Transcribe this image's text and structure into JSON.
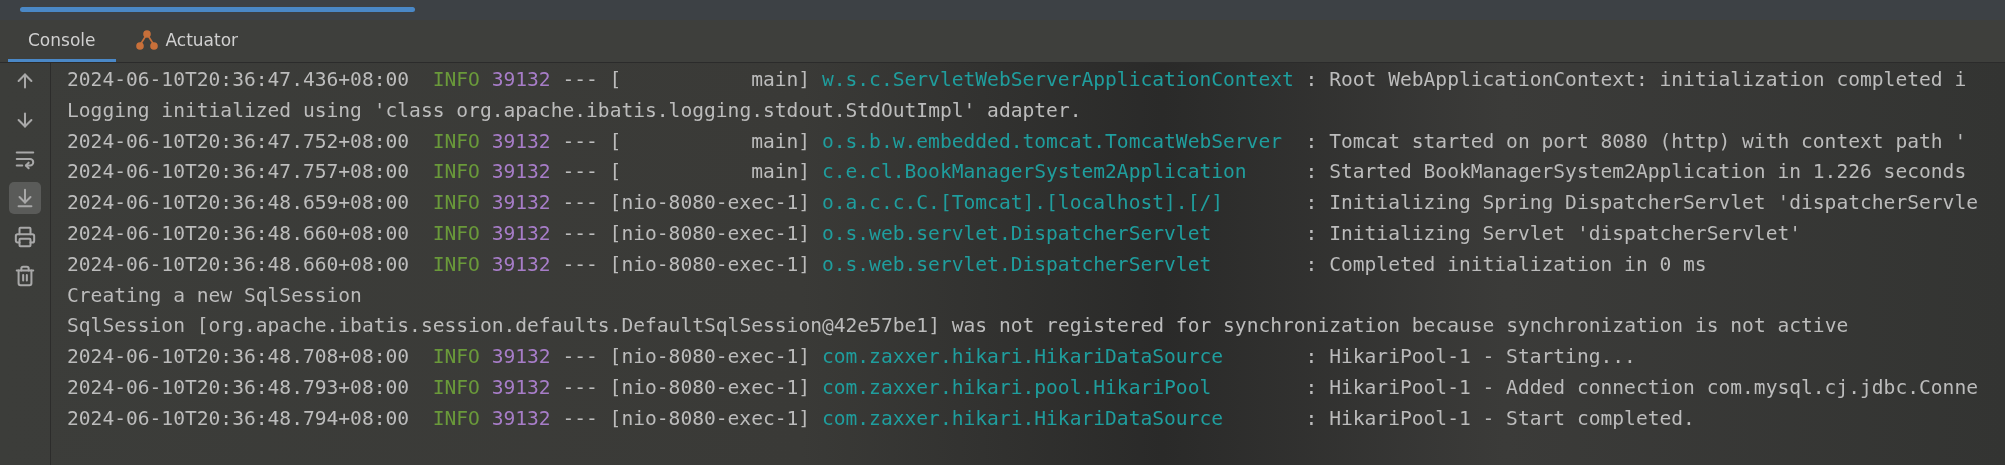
{
  "run_tab": {
    "selected": true
  },
  "tabs": [
    {
      "label": "Console",
      "kind": "plain",
      "selected": true
    },
    {
      "label": "Actuator",
      "kind": "actuator",
      "selected": false
    }
  ],
  "toolbar": [
    {
      "kind": "up",
      "on": false
    },
    {
      "kind": "down",
      "on": false
    },
    {
      "kind": "wrap",
      "on": false
    },
    {
      "kind": "scroll-end",
      "on": true
    },
    {
      "kind": "print",
      "on": false
    },
    {
      "kind": "trash",
      "on": false
    }
  ],
  "lines": [
    {
      "kind": "log",
      "timestamp": "2024-06-10T20:36:47.436+08:00",
      "level": "INFO",
      "pid": "39132",
      "thread": "--- [           main]",
      "logger": "w.s.c.ServletWebServerApplicationContext",
      "message": ": Root WebApplicationContext: initialization completed i"
    },
    {
      "kind": "plain",
      "text": "Logging initialized using 'class org.apache.ibatis.logging.stdout.StdOutImpl' adapter."
    },
    {
      "kind": "log",
      "timestamp": "2024-06-10T20:36:47.752+08:00",
      "level": "INFO",
      "pid": "39132",
      "thread": "--- [           main]",
      "logger": "o.s.b.w.embedded.tomcat.TomcatWebServer",
      "message": ": Tomcat started on port 8080 (http) with context path '"
    },
    {
      "kind": "log",
      "timestamp": "2024-06-10T20:36:47.757+08:00",
      "level": "INFO",
      "pid": "39132",
      "thread": "--- [           main]",
      "logger": "c.e.cl.BookManagerSystem2Application",
      "message": ": Started BookManagerSystem2Application in 1.226 seconds"
    },
    {
      "kind": "log",
      "timestamp": "2024-06-10T20:36:48.659+08:00",
      "level": "INFO",
      "pid": "39132",
      "thread": "--- [nio-8080-exec-1]",
      "logger": "o.a.c.c.C.[Tomcat].[localhost].[/]",
      "message": ": Initializing Spring DispatcherServlet 'dispatcherServle"
    },
    {
      "kind": "log",
      "timestamp": "2024-06-10T20:36:48.660+08:00",
      "level": "INFO",
      "pid": "39132",
      "thread": "--- [nio-8080-exec-1]",
      "logger": "o.s.web.servlet.DispatcherServlet",
      "message": ": Initializing Servlet 'dispatcherServlet'"
    },
    {
      "kind": "log",
      "timestamp": "2024-06-10T20:36:48.660+08:00",
      "level": "INFO",
      "pid": "39132",
      "thread": "--- [nio-8080-exec-1]",
      "logger": "o.s.web.servlet.DispatcherServlet",
      "message": ": Completed initialization in 0 ms"
    },
    {
      "kind": "plain",
      "text": "Creating a new SqlSession"
    },
    {
      "kind": "plain",
      "text": "SqlSession [org.apache.ibatis.session.defaults.DefaultSqlSession@42e57be1] was not registered for synchronization because synchronization is not active"
    },
    {
      "kind": "log",
      "timestamp": "2024-06-10T20:36:48.708+08:00",
      "level": "INFO",
      "pid": "39132",
      "thread": "--- [nio-8080-exec-1]",
      "logger": "com.zaxxer.hikari.HikariDataSource",
      "message": ": HikariPool-1 - Starting..."
    },
    {
      "kind": "log",
      "timestamp": "2024-06-10T20:36:48.793+08:00",
      "level": "INFO",
      "pid": "39132",
      "thread": "--- [nio-8080-exec-1]",
      "logger": "com.zaxxer.hikari.pool.HikariPool",
      "message": ": HikariPool-1 - Added connection com.mysql.cj.jdbc.Conne"
    },
    {
      "kind": "log",
      "timestamp": "2024-06-10T20:36:48.794+08:00",
      "level": "INFO",
      "pid": "39132",
      "thread": "--- [nio-8080-exec-1]",
      "logger": "com.zaxxer.hikari.HikariDataSource",
      "message": ": HikariPool-1 - Start completed."
    }
  ]
}
